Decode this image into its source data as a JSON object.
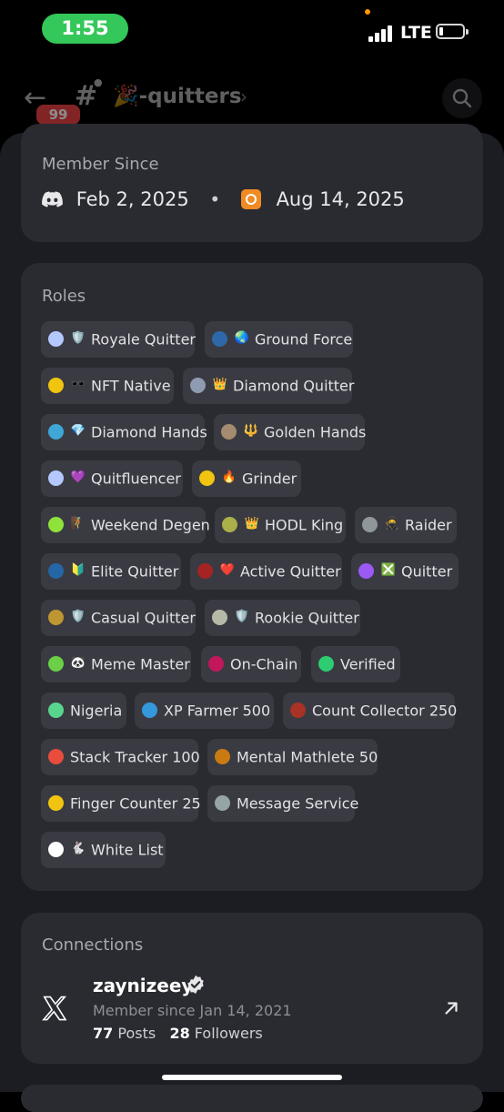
{
  "status_bar": {
    "time": "1:55",
    "network": "LTE"
  },
  "header": {
    "badge_count": "99",
    "channel_name": "🎉-quitters"
  },
  "member_since": {
    "title": "Member Since",
    "discord_date": "Feb 2, 2025",
    "separator": "•",
    "server_date": "Aug 14, 2025"
  },
  "roles": {
    "title": "Roles",
    "items": [
      {
        "label": "Royale Quitter",
        "emoji": "🛡️",
        "color": "#b4c8ff"
      },
      {
        "label": "Ground Force",
        "emoji": "🌏",
        "color": "#2f68a8"
      },
      {
        "label": "NFT Native",
        "emoji": "🕶️",
        "color": "#f1c40f"
      },
      {
        "label": "Diamond Quitter",
        "emoji": "👑",
        "color": "#8f9bb0"
      },
      {
        "label": "Diamond Hands",
        "emoji": "💎",
        "color": "#3fa7d6"
      },
      {
        "label": "Golden Hands",
        "emoji": "🔱",
        "color": "#a58b70"
      },
      {
        "label": "Quitfluencer",
        "emoji": "💜",
        "color": "#b4c8ff"
      },
      {
        "label": "Grinder",
        "emoji": "🔥",
        "color": "#f1c40f"
      },
      {
        "label": "Weekend Degen",
        "emoji": "🧗",
        "color": "#8fe23a"
      },
      {
        "label": "HODL King",
        "emoji": "👑",
        "color": "#aab04a"
      },
      {
        "label": "Raider",
        "emoji": "🥷",
        "color": "#8f9799"
      },
      {
        "label": "Elite Quitter",
        "emoji": "🔰",
        "color": "#2466a6"
      },
      {
        "label": "Active Quitter",
        "emoji": "❤️",
        "color": "#a52323"
      },
      {
        "label": "Quitter",
        "emoji": "❎",
        "color": "#9b59f6"
      },
      {
        "label": "Casual Quitter",
        "emoji": "🛡️",
        "color": "#bf9732"
      },
      {
        "label": "Rookie Quitter",
        "emoji": "🛡️",
        "color": "#b7b9a8"
      },
      {
        "label": "Meme Master",
        "emoji": "🐼",
        "color": "#6bcf47"
      },
      {
        "label": "On-Chain",
        "emoji": "",
        "color": "#c2185b"
      },
      {
        "label": "Verified",
        "emoji": "",
        "color": "#2ecc71"
      },
      {
        "label": "Nigeria",
        "emoji": "",
        "color": "#58d68d"
      },
      {
        "label": "XP Farmer 500",
        "emoji": "",
        "color": "#3498db"
      },
      {
        "label": "Count Collector 250",
        "emoji": "",
        "color": "#a93226"
      },
      {
        "label": "Stack Tracker 100",
        "emoji": "",
        "color": "#e74c3c"
      },
      {
        "label": "Mental Mathlete 50",
        "emoji": "",
        "color": "#ca7a12"
      },
      {
        "label": "Finger Counter 25",
        "emoji": "",
        "color": "#f1c40f"
      },
      {
        "label": "Message Service",
        "emoji": "",
        "color": "#95a5a6"
      },
      {
        "label": "White List",
        "emoji": "🐇",
        "color": "#ffffff"
      }
    ]
  },
  "connections": {
    "title": "Connections",
    "account": {
      "name": "zaynizeey",
      "since": "Member since Jan 14, 2021",
      "posts_count": "77",
      "posts_label": "Posts",
      "followers_count": "28",
      "followers_label": "Followers"
    }
  },
  "colors": {
    "status_pill": "#34c759",
    "badge": "#ed4245",
    "server_icon": "#f08a24"
  },
  "icons": [
    "back-arrow-icon",
    "hash-icon",
    "lock-icon",
    "chevron-right-icon",
    "search-icon",
    "discord-icon",
    "server-icon",
    "x-logo-icon",
    "verified-icon",
    "external-link-icon"
  ]
}
